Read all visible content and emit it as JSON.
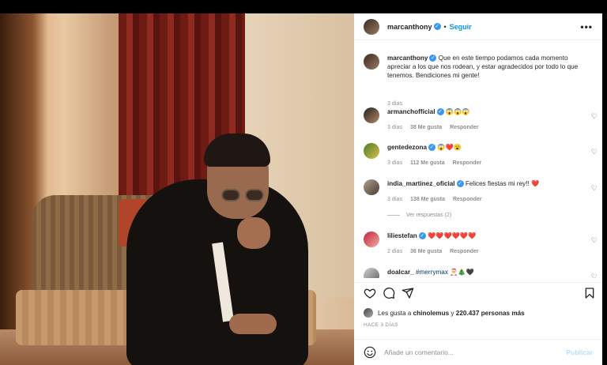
{
  "header": {
    "username": "marcanthony",
    "separator": "•",
    "follow_label": "Seguir",
    "more_label": "•••"
  },
  "caption": {
    "username": "marcanthony",
    "text": "Que en este tiempo podamos cada momento apreciar a los que nos rodean, y estar agradecidos por todo lo que tenemos. Bendiciones mi gente!",
    "time": "3 días"
  },
  "comments": [
    {
      "username": "armanchofficial",
      "text": "😱😱😱",
      "time": "3 días",
      "likes": "38 Me gusta",
      "reply": "Responder"
    },
    {
      "username": "gentedezona",
      "text": "😱❤️😮",
      "time": "3 días",
      "likes": "112 Me gusta",
      "reply": "Responder"
    },
    {
      "username": "india_martinez_oficial",
      "text": "Felices fiestas mi rey!! ❤️",
      "time": "3 días",
      "likes": "138 Me gusta",
      "reply": "Responder",
      "view_replies": "Ver respuestas (2)"
    },
    {
      "username": "liliestefan",
      "text": "❤️❤️❤️❤️❤️❤️",
      "time": "2 días",
      "likes": "36 Me gusta",
      "reply": "Responder"
    },
    {
      "username": "doalcar_",
      "text": "#merrymax 🎅🎄🖤"
    }
  ],
  "likes": {
    "prefix": "Les gusta a",
    "user": "chinolemus",
    "connector": "y",
    "count": "220.437 personas más"
  },
  "posted_ago": "HACE 3 DÍAS",
  "add_comment": {
    "placeholder": "Añade un comentario...",
    "publish_label": "Publicar"
  },
  "icons": [
    "heart-icon",
    "comment-icon",
    "share-icon",
    "bookmark-icon",
    "emoji-icon",
    "verified-icon",
    "more-options-icon"
  ],
  "colors": {
    "link": "#0095f6",
    "verified": "#3897f0",
    "muted": "#8e8e8e",
    "publish_disabled": "#b2dffc"
  }
}
